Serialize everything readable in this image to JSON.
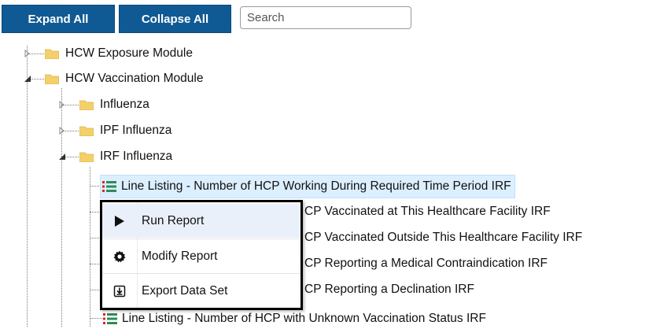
{
  "toolbar": {
    "expand_all_label": "Expand All",
    "collapse_all_label": "Collapse All",
    "search_placeholder": "Search"
  },
  "tree": {
    "hcw_exposure": "HCW Exposure Module",
    "hcw_vaccination": "HCW Vaccination Module",
    "influenza": "Influenza",
    "ipf_influenza": "IPF Influenza",
    "irf_influenza": "IRF Influenza",
    "reports": [
      "Line Listing - Number of HCP Working During Required Time Period IRF",
      "CP Vaccinated at This Healthcare Facility IRF",
      "CP Vaccinated Outside This Healthcare Facility IRF",
      "CP Reporting a Medical Contraindication IRF",
      "CP Reporting a Declination IRF",
      "Line Listing - Number of HCP with Unknown Vaccination Status IRF"
    ]
  },
  "context_menu": {
    "items": [
      {
        "label": "Run Report",
        "icon": "play-icon"
      },
      {
        "label": "Modify Report",
        "icon": "gear-icon"
      },
      {
        "label": "Export Data Set",
        "icon": "export-icon"
      }
    ]
  },
  "colors": {
    "button_bg": "#0f5a94",
    "selected_bg": "#dcefff",
    "folder": "#f4d06a",
    "report_red": "#d9262b",
    "report_green": "#2e8b57"
  }
}
